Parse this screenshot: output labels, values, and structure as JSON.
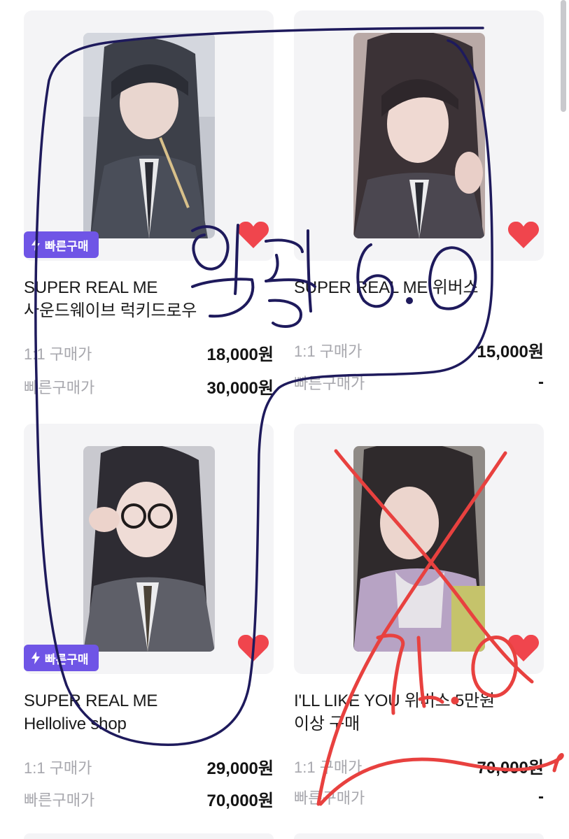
{
  "products": [
    {
      "title_line1": "SUPER REAL ME",
      "title_line2": "사운드웨이브 럭키드로우",
      "quick_badge": "빠른구매",
      "price_1to1_label": "1:1 구매가",
      "price_1to1": "18,000원",
      "price_quick_label": "빠른구매가",
      "price_quick": "30,000원"
    },
    {
      "title_line1": "SUPER REAL ME 위버스",
      "title_line2": "",
      "quick_badge": "",
      "price_1to1_label": "1:1 구매가",
      "price_1to1": "15,000원",
      "price_quick_label": "빠른구매가",
      "price_quick": "-"
    },
    {
      "title_line1": "SUPER REAL ME",
      "title_line2": "Hellolive shop",
      "quick_badge": "빠른구매",
      "price_1to1_label": "1:1 구매가",
      "price_1to1": "29,000원",
      "price_quick_label": "빠른구매가",
      "price_quick": "70,000원"
    },
    {
      "title_line1": "I'LL LIKE YOU 위버스 5만원",
      "title_line2": "이상 구매",
      "quick_badge": "",
      "price_1to1_label": "1:1 구매가",
      "price_1to1": "70,000원",
      "price_quick_label": "빠른구매가",
      "price_quick": "-"
    }
  ],
  "annotations": {
    "handwritten_note_1": "일괄 6.0",
    "handwritten_note_2": "7.0"
  },
  "icons": {
    "quick_badge": "lightning-icon",
    "wishlist": "heart-icon"
  },
  "colors": {
    "accent": "#6f55e6",
    "heart": "#f0454d",
    "card_bg": "#f4f4f6",
    "pen_blue": "#1e1a5c",
    "pen_red": "#e8413f"
  }
}
